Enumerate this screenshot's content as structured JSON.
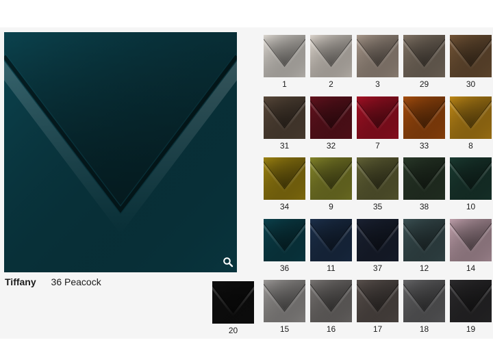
{
  "selected": {
    "product": "Tiffany",
    "label": "36 Peacock",
    "color": "#0c4652"
  },
  "zoom_icon": "magnifier-icon",
  "swatches": [
    {
      "num": "1",
      "color": "#e8e3dc"
    },
    {
      "num": "2",
      "color": "#e9e1d8"
    },
    {
      "num": "3",
      "color": "#b3a294"
    },
    {
      "num": "29",
      "color": "#8a7c6d"
    },
    {
      "num": "30",
      "color": "#7a5a3a"
    },
    {
      "num": "31",
      "color": "#5e4d3e"
    },
    {
      "num": "32",
      "color": "#6a1420"
    },
    {
      "num": "7",
      "color": "#b01227"
    },
    {
      "num": "33",
      "color": "#b0520e"
    },
    {
      "num": "8",
      "color": "#c99018"
    },
    {
      "num": "34",
      "color": "#a58a12"
    },
    {
      "num": "9",
      "color": "#8b8c2c"
    },
    {
      "num": "35",
      "color": "#6a6a3a"
    },
    {
      "num": "38",
      "color": "#2c3d2c"
    },
    {
      "num": "10",
      "color": "#1c3e34"
    },
    {
      "num": "36",
      "color": "#0c4652"
    },
    {
      "num": "11",
      "color": "#1e3350"
    },
    {
      "num": "37",
      "color": "#1c2436"
    },
    {
      "num": "12",
      "color": "#3e5558"
    },
    {
      "num": "14",
      "color": "#c9a8b4"
    },
    {
      "num": "20",
      "color": "#111111"
    },
    {
      "num": "15",
      "color": "#a5a2a0"
    },
    {
      "num": "16",
      "color": "#807c7a"
    },
    {
      "num": "17",
      "color": "#5f5652"
    },
    {
      "num": "18",
      "color": "#6b6b6d"
    },
    {
      "num": "19",
      "color": "#2e2d2f"
    }
  ]
}
